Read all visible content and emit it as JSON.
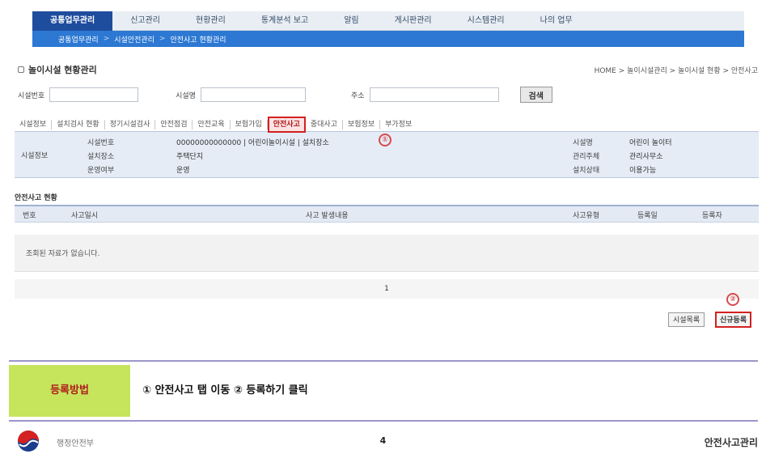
{
  "gnb": {
    "items": [
      "공통업무관리",
      "신고관리",
      "현황관리",
      "통계분석 보고",
      "알림",
      "게시판관리",
      "시스템관리",
      "나의 업무"
    ],
    "active_index": 0
  },
  "lnb": {
    "crumbs": [
      "공통업무관리",
      "시설안전관리",
      "안전사고 현황관리"
    ]
  },
  "page": {
    "title": "놀이시설 현황관리",
    "breadcrumb": "HOME > 놀이시설관리 > 놀이시설 현황 > 안전사고"
  },
  "search": {
    "field1_label": "시설번호",
    "field1_value": "",
    "field2_label": "시설명",
    "field2_value": "",
    "field3_label": "주소",
    "field3_value": "",
    "button_label": "검색"
  },
  "tabs": [
    "시설정보",
    "설치검사 현황",
    "정기시설검사",
    "안전점검",
    "안전교육",
    "보험가입",
    "안전사고",
    "중대사고",
    "보험정보",
    "부가정보"
  ],
  "active_tab": 6,
  "steps": {
    "step1": "①",
    "step2": "②"
  },
  "facility": {
    "category": "시설정보",
    "rows": [
      {
        "label": "시설번호",
        "value": "00000000000000 | 어린이놀이시설 | 설치장소",
        "right_label": "시설명",
        "right_value": "어린이 놀이터"
      },
      {
        "label": "설치장소",
        "value": "주택단지",
        "right_label": "관리주체",
        "right_value": "관리사무소"
      },
      {
        "label": "운영여부",
        "value": "운영",
        "right_label": "설치상태",
        "right_value": "이용가능"
      }
    ]
  },
  "accidents": {
    "section_title": "안전사고 현황",
    "columns": [
      "번호",
      "사고일시",
      "사고 발생내용",
      "사고유형",
      "등록일",
      "등록자"
    ],
    "empty_message": "조회된 자료가 없습니다.",
    "pagination": "1"
  },
  "actions": {
    "list_label": "시설목록",
    "register_label": "신규등록"
  },
  "guide": {
    "label": "등록방법",
    "text": "① 안전사고 탭 이동 ② 등록하기 클릭"
  },
  "footer": {
    "ministry": "행정안전부",
    "page_number": "4",
    "right_text": "안전사고관리"
  }
}
